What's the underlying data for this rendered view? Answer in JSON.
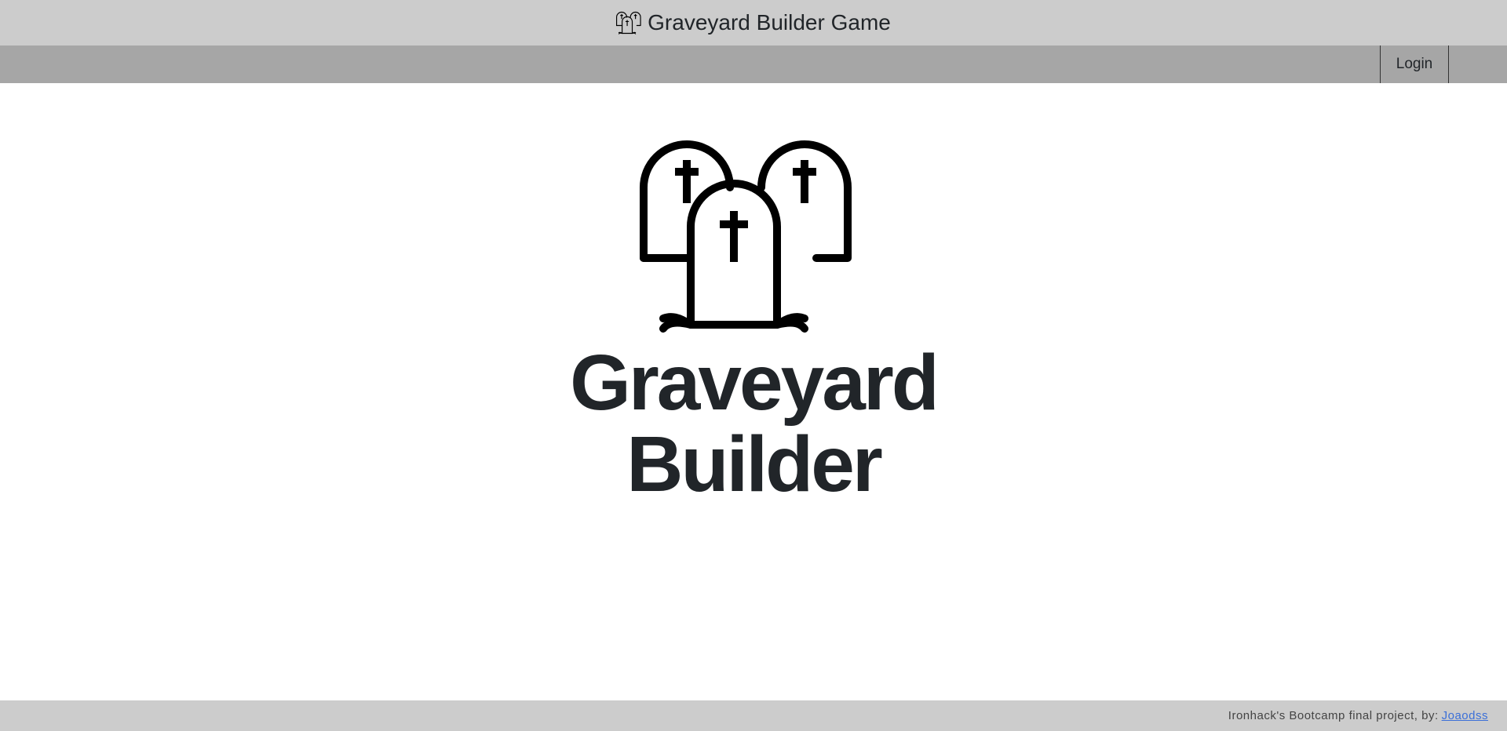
{
  "header": {
    "title": "Graveyard Builder Game",
    "logo_icon": "graveyard-icon"
  },
  "nav": {
    "login_label": "Login"
  },
  "hero": {
    "logo_icon": "graveyard-icon",
    "title_line1": "Graveyard",
    "title_line2": "Builder"
  },
  "footer": {
    "text": "Ironhack's Bootcamp final project, by:",
    "author_link": "Joaodss"
  },
  "colors": {
    "header_bg": "#cccccc",
    "nav_bg": "#a6a6a6",
    "footer_bg": "#cccccc",
    "link": "#3b6fd8",
    "text": "#212529"
  }
}
